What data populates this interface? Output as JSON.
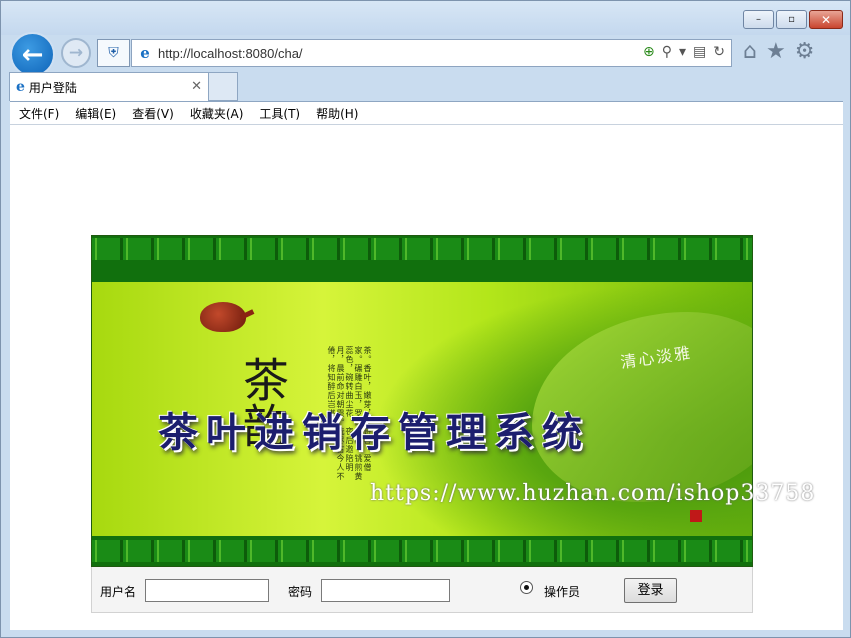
{
  "browser": {
    "address_url": "http://localhost:8080/cha/",
    "tab_title": "用户登陆",
    "window_buttons": [
      "–",
      "▫",
      "✕"
    ]
  },
  "menu": {
    "items": [
      "文件(F)",
      "编辑(E)",
      "查看(V)",
      "收藏夹(A)",
      "工具(T)",
      "帮助(H)"
    ]
  },
  "banner": {
    "system_title": "茶叶进销存管理系统",
    "calligraphy": "茶韵",
    "slogan": "清心淡雅",
    "poem": "茶。香叶，嫩芽，慕诗客，爱僧家。碾雕白玉，罗织红纱。铫煎黄蕊色，碗转曲尘花。夜后邀陪明月，晨前命对朝霞。洗尽古今人不倦，将知醉后岂堪夸。",
    "watermark": "https://www.huzhan.com/ishop33758"
  },
  "login": {
    "username_label": "用户名",
    "username_value": "",
    "password_label": "密码",
    "password_value": "",
    "role_label": "操作员",
    "role_selected": true,
    "submit_label": "登录"
  },
  "colors": {
    "title_text": "#1c1e6e",
    "banner_green": "#90cf0d",
    "border_green": "#11700d"
  }
}
